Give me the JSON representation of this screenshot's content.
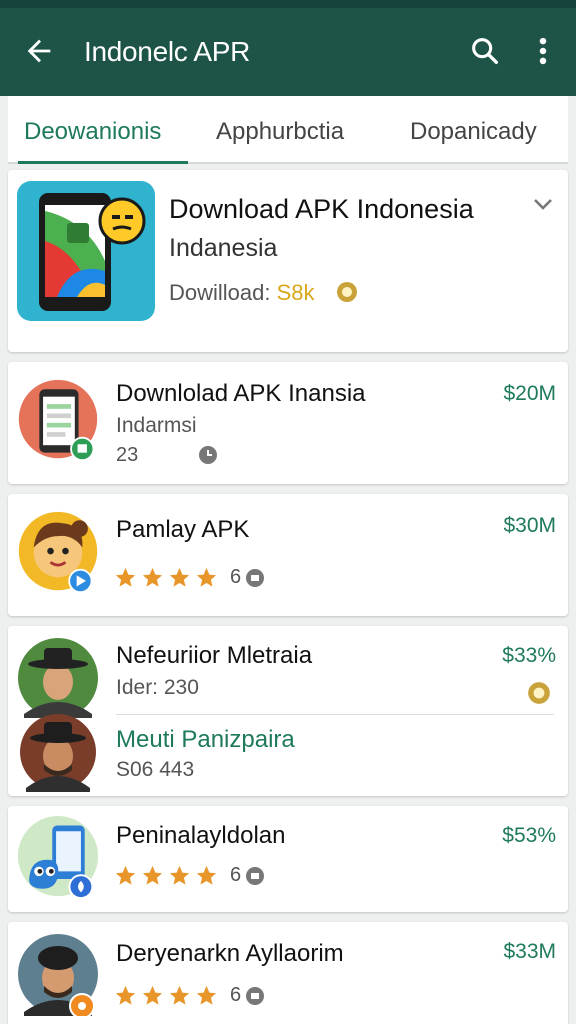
{
  "appbar": {
    "title": "Indonelc APR",
    "back_icon": "arrow-left-icon",
    "search_icon": "search-icon",
    "more_icon": "more-vert-icon"
  },
  "tabs": [
    {
      "label": "Deowanionis",
      "active": true
    },
    {
      "label": "Apphurbctia",
      "active": false
    },
    {
      "label": "Dopanicady",
      "active": false
    }
  ],
  "featured": {
    "name": "Download APK Indonesia",
    "subtitle": "Indanesia",
    "download_label": "Dowilload:",
    "download_count": "S8k"
  },
  "items": [
    {
      "name": "Downlolad APK Inansia",
      "subtitle": "Indarmsi",
      "meta": "23",
      "price": "$20M"
    },
    {
      "name": "Pamlay APK",
      "rating_count": "6",
      "price": "$30M"
    },
    {
      "name": "Nefeuriior Mletraia",
      "subtitle": "Ider: 230",
      "price": "$33%",
      "secondary_name": "Meuti Panizpaira",
      "secondary_sub": "S06 443"
    },
    {
      "name": "Peninalayldolan",
      "rating_count": "6",
      "price": "$53%"
    },
    {
      "name": "Deryenarkn Ayllaorim",
      "rating_count": "6",
      "price": "$33M"
    }
  ],
  "colors": {
    "appbar": "#1e5448",
    "accent": "#1e7a5a",
    "star": "#e8962a"
  }
}
